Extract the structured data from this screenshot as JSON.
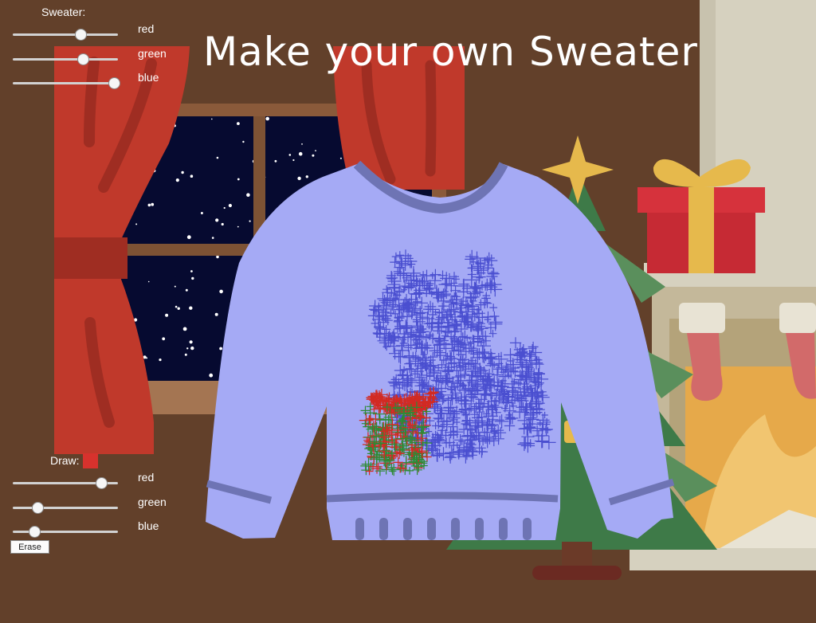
{
  "title": "Make your own Sweater",
  "sweater_panel": {
    "label": "Sweater:",
    "sliders": [
      {
        "label": "red",
        "value": 165,
        "max": 255
      },
      {
        "label": "green",
        "value": 170,
        "max": 255
      },
      {
        "label": "blue",
        "value": 245,
        "max": 255
      }
    ]
  },
  "draw_panel": {
    "label": "Draw:",
    "sliders": [
      {
        "label": "red",
        "value": 215,
        "max": 255
      },
      {
        "label": "green",
        "value": 60,
        "max": 255
      },
      {
        "label": "blue",
        "value": 52,
        "max": 255
      }
    ],
    "swatch_color": "#d7322d",
    "erase_label": "Erase"
  },
  "colors": {
    "wall": "#62402a",
    "sweater": "#a5aaf5",
    "curtain": "#c0392b",
    "night_sky": "#060a30",
    "tree": "#3e7a48",
    "gift": "#d6323c",
    "gift_ribbon": "#e6b94c"
  }
}
